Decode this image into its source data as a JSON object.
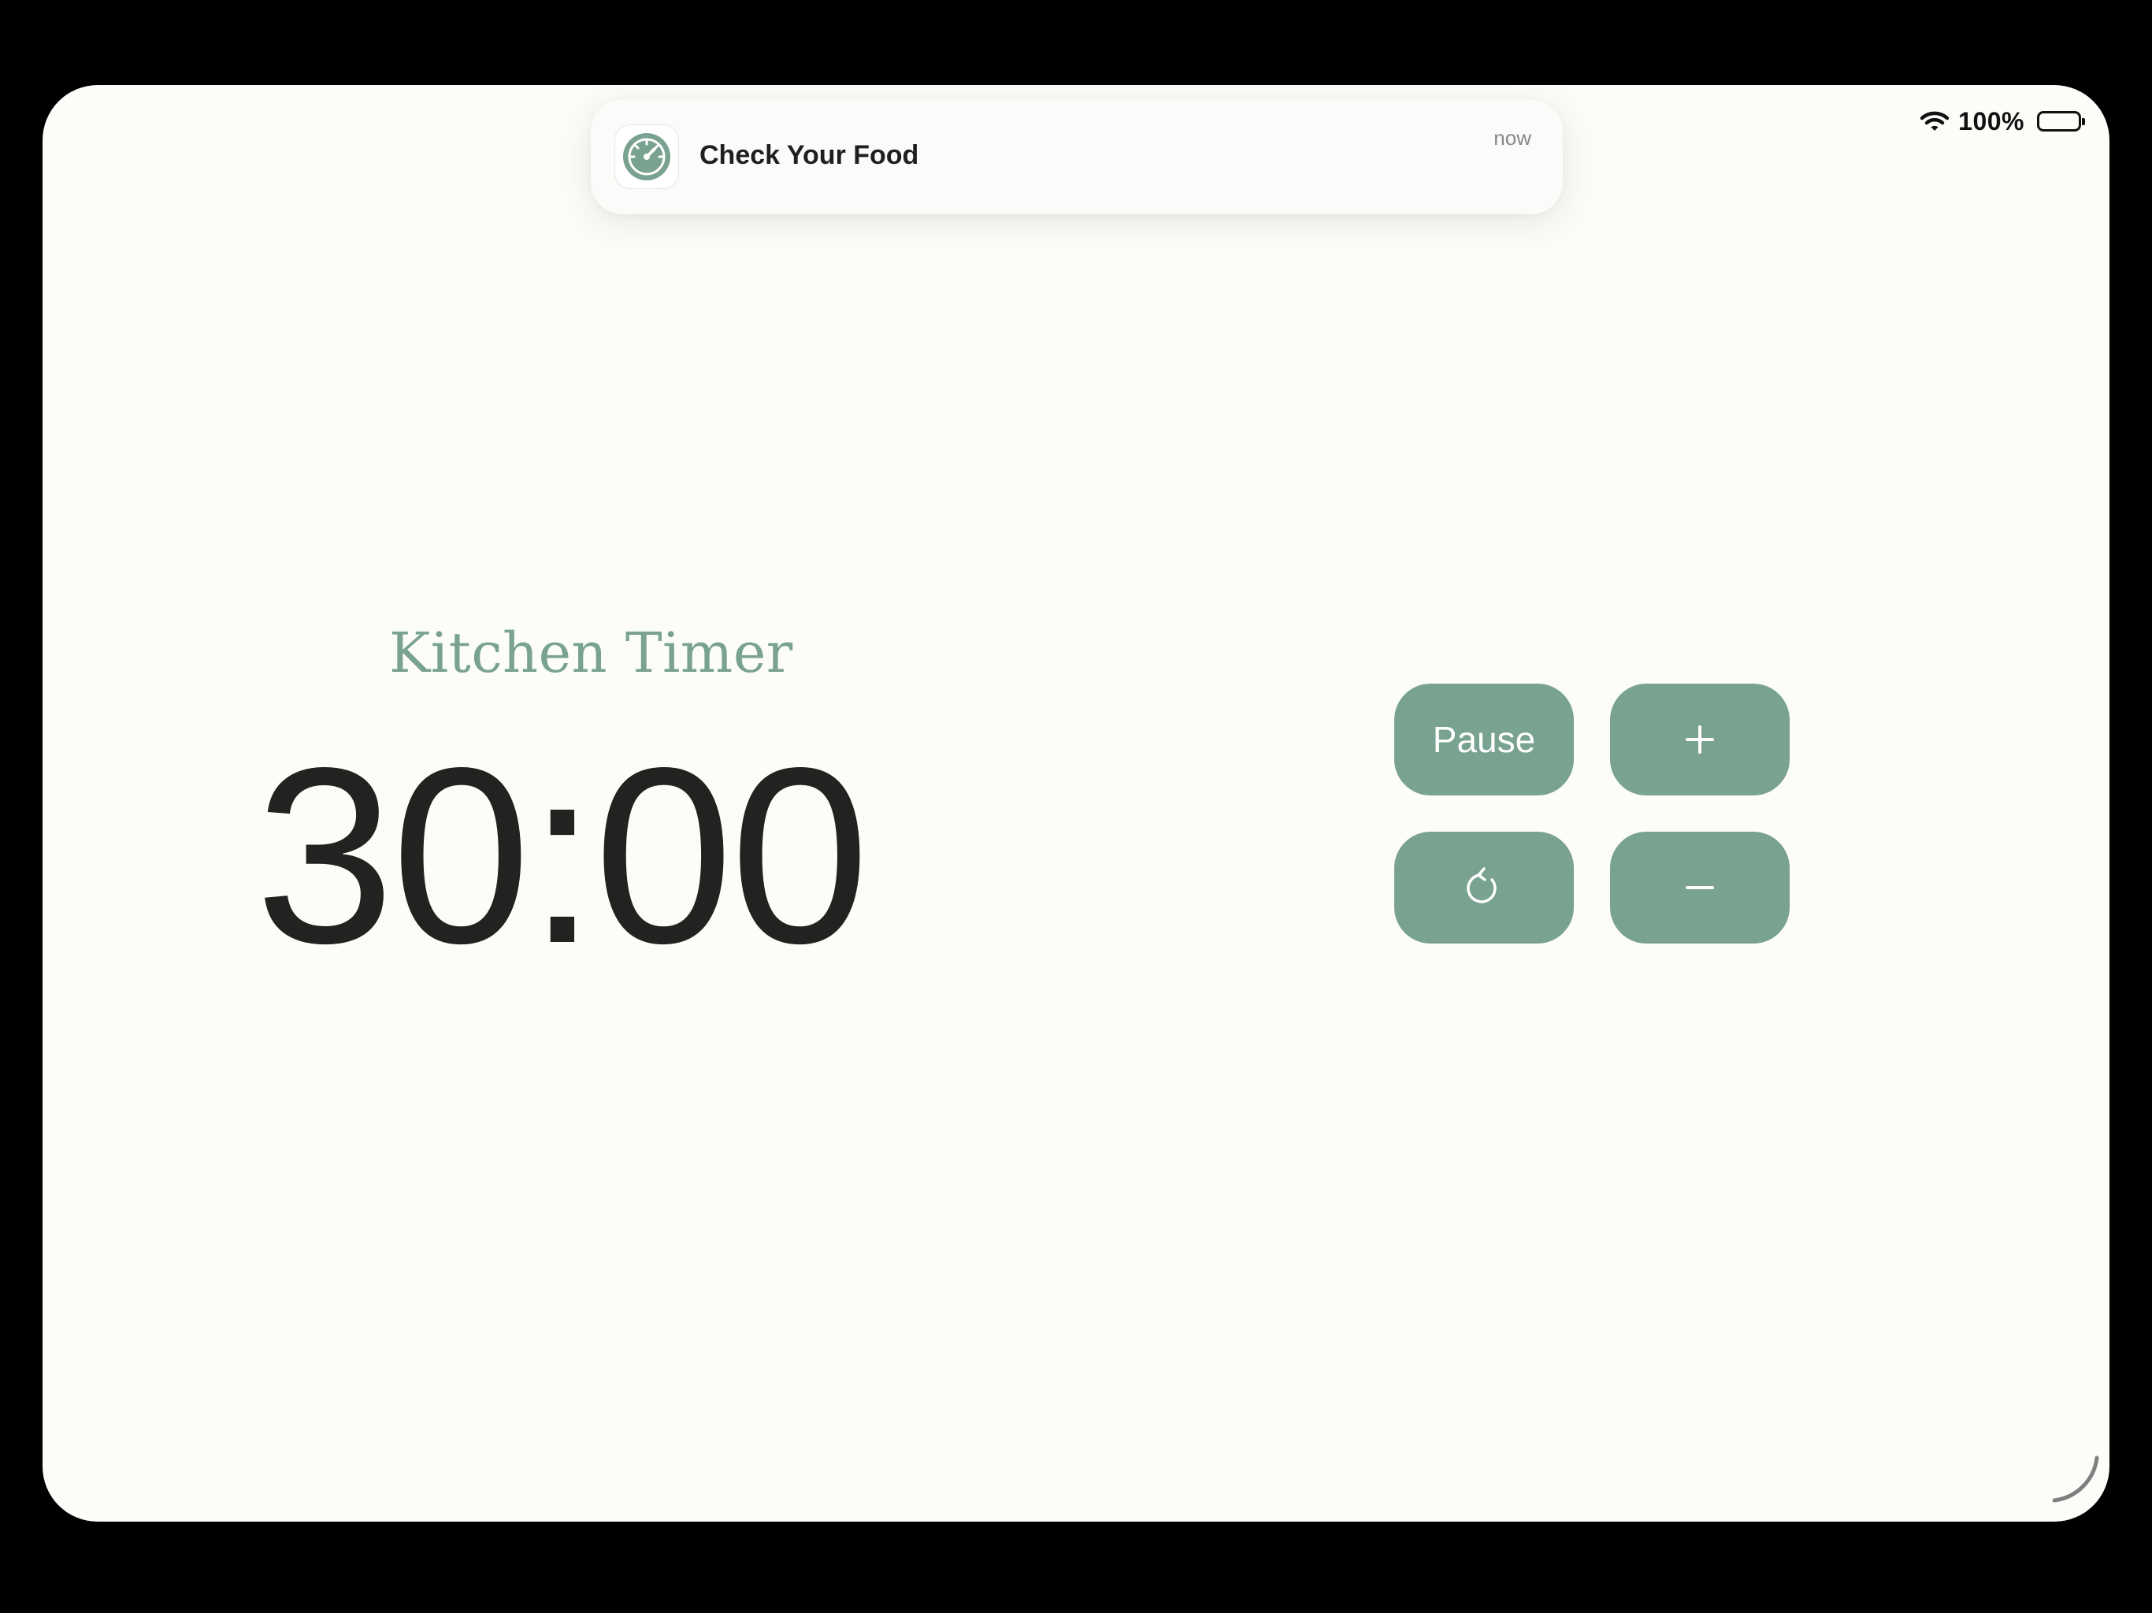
{
  "status_bar": {
    "battery_percent": "100%",
    "wifi_icon": "wifi-icon",
    "battery_icon": "battery-full-icon"
  },
  "notification": {
    "icon": "timer-gauge-icon",
    "title": "Check Your Food",
    "time": "now"
  },
  "timer": {
    "title": "Kitchen Timer",
    "value": "30:00"
  },
  "controls": {
    "pause_label": "Pause",
    "increment_icon": "plus-icon",
    "reset_icon": "reset-icon",
    "decrement_icon": "minus-icon"
  },
  "colors": {
    "accent": "#79a291",
    "background": "#fcfdf9",
    "text": "#232220"
  }
}
